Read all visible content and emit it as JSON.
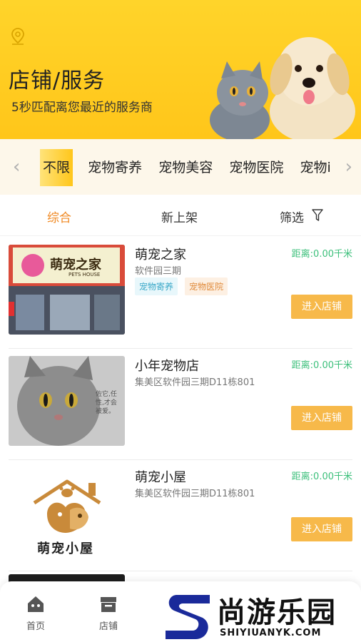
{
  "banner": {
    "title": "店铺/服务",
    "subtitle": "5秒匹配离您最近的服务商"
  },
  "categories": {
    "items": [
      "不限",
      "宠物寄养",
      "宠物美容",
      "宠物医院",
      "宠物i"
    ],
    "active_index": 0
  },
  "sort": {
    "items": [
      "综合",
      "新上架",
      "筛选"
    ],
    "active_index": 0
  },
  "stores": [
    {
      "name": "萌宠之家",
      "address": "软件园三期",
      "distance": "距离:0.00千米",
      "tags": [
        "宠物寄养",
        "宠物医院"
      ],
      "button": "进入店铺",
      "sign_text": "萌宠之家",
      "sign_sub": "PETS HOUSE"
    },
    {
      "name": "小年宠物店",
      "address": "集美区软件园三期D11栋801",
      "distance": "距离:0.00千米",
      "tags": [],
      "button": "进入店铺",
      "photo_text": "佐它,任性,才会被爱。"
    },
    {
      "name": "萌宠小屋",
      "address": "集美区软件园三期D11栋801",
      "distance": "距离:0.00千米",
      "tags": [],
      "button": "进入店铺",
      "logo_text": "萌宠小屋"
    }
  ],
  "bottom_nav": {
    "items": [
      "首页",
      "店铺"
    ]
  },
  "watermark": {
    "cn": "尚游乐园",
    "en": "SHIYIUANYK.COM"
  },
  "colors": {
    "banner": "#ffc61a",
    "accent": "#f08a24",
    "button": "#f7b94a",
    "distance": "#3bbf7a"
  }
}
